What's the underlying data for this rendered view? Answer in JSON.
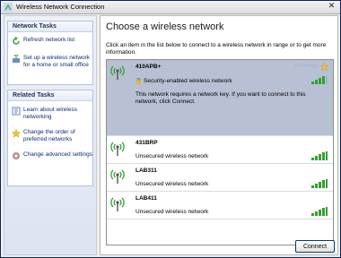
{
  "window": {
    "title": "Wireless Network Connection",
    "close_glyph": "✕"
  },
  "sidebar": {
    "network_tasks": {
      "header": "Network Tasks",
      "items": [
        {
          "label": "Refresh network list",
          "icon": "refresh-icon"
        },
        {
          "label": "Set up a wireless network for a home or small office",
          "icon": "setup-wireless-icon"
        }
      ]
    },
    "related_tasks": {
      "header": "Related Tasks",
      "items": [
        {
          "label": "Learn about wireless networking",
          "icon": "info-icon"
        },
        {
          "label": "Change the order of preferred networks",
          "icon": "star-icon"
        },
        {
          "label": "Change advanced settings",
          "icon": "advanced-settings-icon"
        }
      ]
    }
  },
  "main": {
    "heading": "Choose a wireless network",
    "intro": "Click an item in the list below to connect to a wireless network in range or to get more information.",
    "networks": [
      {
        "ssid": "410APB+",
        "security": "Security-enabled wireless network",
        "selected": true,
        "preferred": true,
        "preferred_label": "Preferred",
        "description": "This network requires a network key. If you want to connect to this network, click Connect.",
        "signal": 4
      },
      {
        "ssid": "431BRP",
        "security": "Unsecured wireless network",
        "signal": 5
      },
      {
        "ssid": "LAB311",
        "security": "Unsecured wireless network",
        "signal": 5
      },
      {
        "ssid": "LAB411",
        "security": "Unsecured wireless network",
        "signal": 5
      }
    ],
    "connect_label": "Connect"
  },
  "colors": {
    "selected_row": "#b8c0d4",
    "signal_green": "#2fa32f",
    "link_blue": "#0b2a7a"
  }
}
